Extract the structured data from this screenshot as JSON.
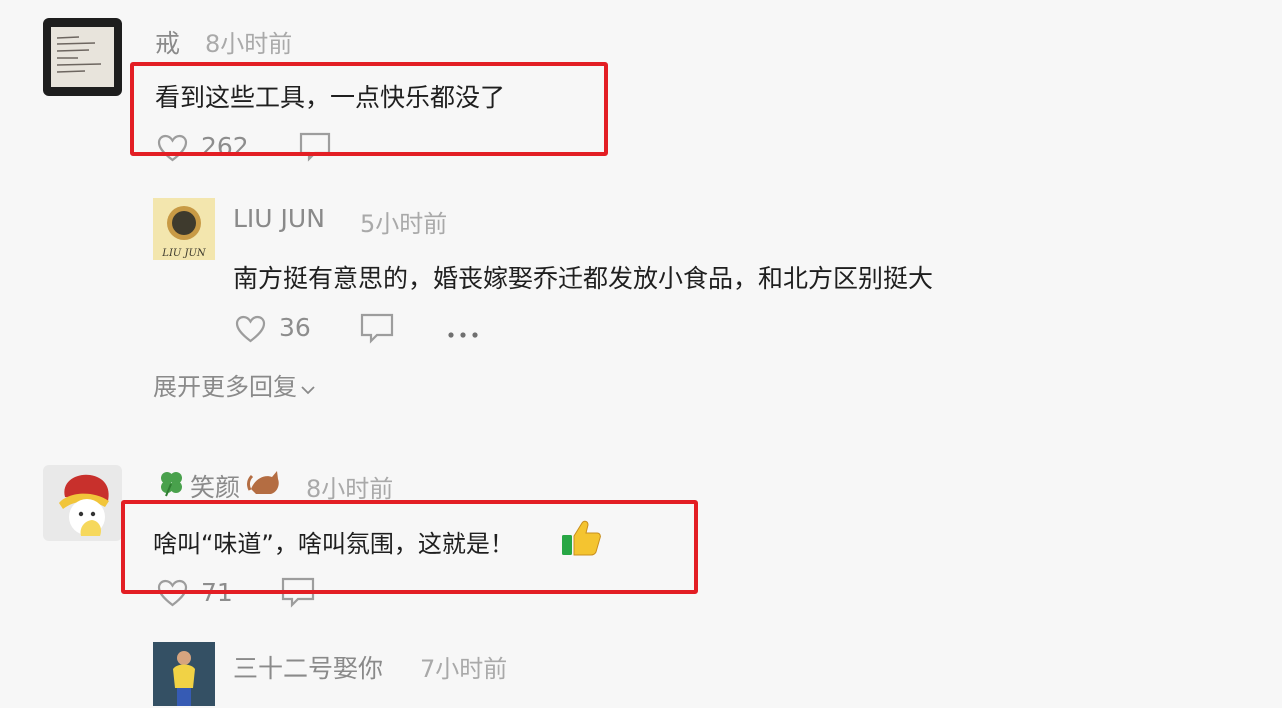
{
  "comments": [
    {
      "username": "戒",
      "time": "8小时前",
      "text": "看到这些工具，一点快乐都没了",
      "likes": "262",
      "highlighted": true
    },
    {
      "username": "LIU JUN",
      "time": "5小时前",
      "text": "南方挺有意思的，婚丧嫁娶乔迁都发放小食品，和北方区别挺大",
      "likes": "36",
      "avatar_text": "LIU JUN"
    },
    {
      "username": "笑颜",
      "time": "8小时前",
      "text": "啥叫“味道”，啥叫氛围，这就是！",
      "likes": "71",
      "highlighted": true
    },
    {
      "username": "三十二号娶你",
      "time": "7小时前"
    }
  ],
  "expand_replies": "展开更多回复",
  "colors": {
    "highlight": "#e31e24",
    "background": "#f7f7f7",
    "meta_text": "#8a8a8a"
  },
  "icons": [
    "heart-icon",
    "comment-icon",
    "more-icon",
    "chevron-down-icon",
    "clover-icon",
    "cat-icon",
    "thumbs-up-icon"
  ]
}
